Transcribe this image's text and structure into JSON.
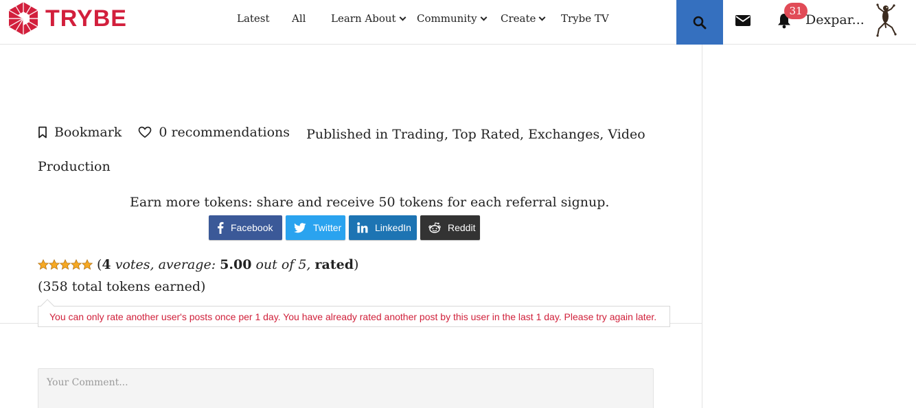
{
  "brand": {
    "name": "TRYBE",
    "color": "#d21f3c"
  },
  "nav": {
    "items": [
      {
        "label": "Latest",
        "dropdown": false
      },
      {
        "label": "All",
        "dropdown": false
      },
      {
        "label": "Learn About",
        "dropdown": true
      },
      {
        "label": "Community",
        "dropdown": true
      },
      {
        "label": "Create",
        "dropdown": true
      },
      {
        "label": "Trybe TV",
        "dropdown": false
      }
    ]
  },
  "header": {
    "search_icon": "search-icon",
    "mail_icon": "envelope-icon",
    "bell_icon": "bell-icon",
    "notification_count": "31",
    "username": "Dexpar...",
    "accent_color": "#3570bf"
  },
  "meta": {
    "bookmark_label": "Bookmark",
    "recommendations_label": "0 recommendations",
    "published_prefix": "Published in",
    "categories": [
      "Trading",
      "Top Rated",
      "Exchanges",
      "Video Production"
    ]
  },
  "share": {
    "text": "Earn more tokens: share and receive 50 tokens for each referral signup.",
    "buttons": [
      {
        "label": "Facebook",
        "icon": "facebook-icon",
        "color": "#3b5998"
      },
      {
        "label": "Twitter",
        "icon": "twitter-icon",
        "color": "#2aa3ef"
      },
      {
        "label": "LinkedIn",
        "icon": "linkedin-icon",
        "color": "#1d74b3"
      },
      {
        "label": "Reddit",
        "icon": "reddit-icon",
        "color": "#333333"
      }
    ]
  },
  "rating": {
    "stars_filled": 5,
    "stars_total": 5,
    "votes": "4",
    "votes_word": "votes, average:",
    "average": "5.00",
    "out_of": "out of 5,",
    "rated_word": "rated",
    "tokens_text": "(358 total tokens earned)"
  },
  "tooltip": {
    "message": "You can only rate another user's posts once per 1 day. You have already rated another post by this user in the last 1 day. Please try again later.",
    "color": "#d0203a"
  },
  "comment": {
    "placeholder": "Your Comment..."
  }
}
